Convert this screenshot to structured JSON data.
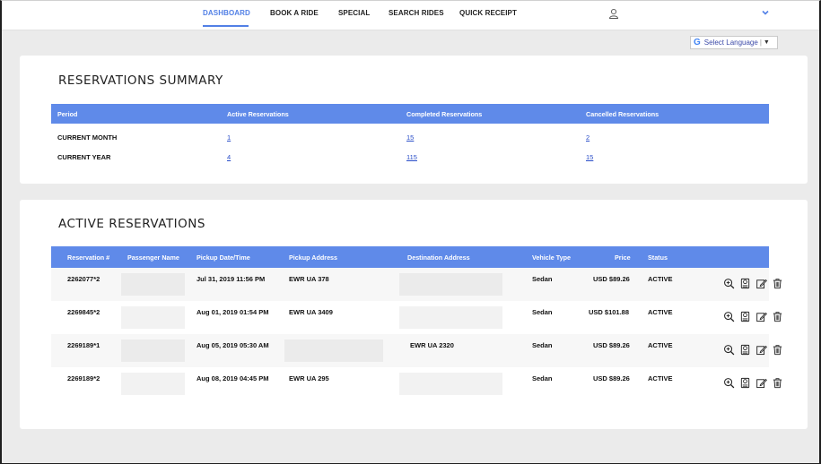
{
  "nav": {
    "items": [
      {
        "label": "DASHBOARD",
        "active": true
      },
      {
        "label": "BOOK A RIDE",
        "active": false
      },
      {
        "label": "SPECIAL",
        "active": false
      },
      {
        "label": "SEARCH RIDES",
        "active": false
      },
      {
        "label": "QUICK RECEIPT",
        "active": false
      }
    ],
    "accent_color": "#5280e6"
  },
  "language": {
    "g_letter": "G",
    "label": "Select Language",
    "arrow": "▼"
  },
  "summary": {
    "title": "RESERVATIONS SUMMARY",
    "headers": [
      "Period",
      "Active Reservations",
      "Completed Reservations",
      "Cancelled Reservations"
    ],
    "rows": [
      {
        "period": "CURRENT MONTH",
        "active": "1",
        "completed": "15",
        "cancelled": "2"
      },
      {
        "period": "CURRENT YEAR",
        "active": "4",
        "completed": "115",
        "cancelled": "15"
      }
    ]
  },
  "active": {
    "title": "ACTIVE RESERVATIONS",
    "headers": [
      "Reservation #",
      "Passenger Name",
      "Pickup Date/Time",
      "Pickup Address",
      "Destination Address",
      "Vehicle Type",
      "Price",
      "Status"
    ],
    "rows": [
      {
        "id": "2262077*2",
        "passenger": "",
        "pickup_time": "Jul 31, 2019 11:56 PM",
        "pickup_address": "EWR UA 378",
        "destination": "",
        "vehicle": "Sedan",
        "price": "USD $89.26",
        "status": "ACTIVE"
      },
      {
        "id": "2269845*2",
        "passenger": "",
        "pickup_time": "Aug 01, 2019 01:54 PM",
        "pickup_address": "EWR UA 3409",
        "destination": "",
        "vehicle": "Sedan",
        "price": "USD $101.88",
        "status": "ACTIVE"
      },
      {
        "id": "2269189*1",
        "passenger": "",
        "pickup_time": "Aug 05, 2019 05:30 AM",
        "pickup_address": "",
        "destination": "EWR UA 2320",
        "vehicle": "Sedan",
        "price": "USD $89.26",
        "status": "ACTIVE"
      },
      {
        "id": "2269189*2",
        "passenger": "",
        "pickup_time": "Aug 08, 2019 04:45 PM",
        "pickup_address": "EWR UA 295",
        "destination": "",
        "vehicle": "Sedan",
        "price": "USD $89.26",
        "status": "ACTIVE"
      }
    ],
    "row_actions": [
      "zoom-in-icon",
      "receipt-icon",
      "edit-icon",
      "trash-icon"
    ]
  }
}
